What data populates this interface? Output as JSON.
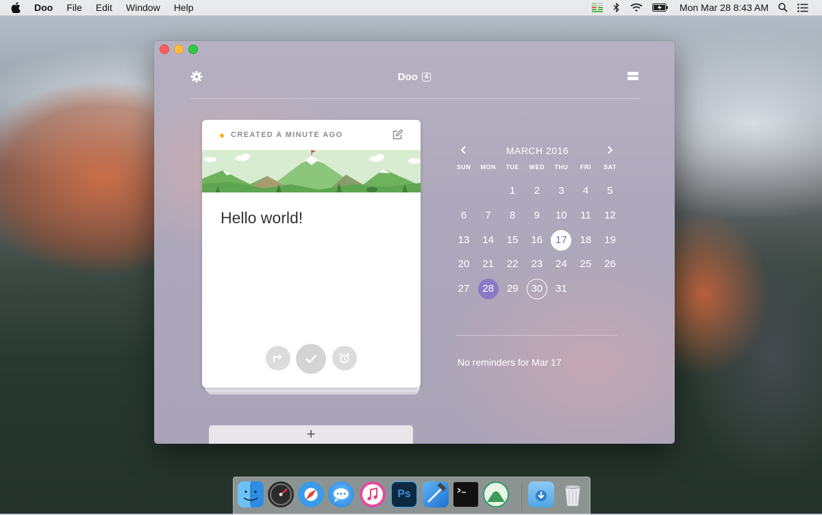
{
  "menubar": {
    "app_name": "Doo",
    "items": [
      "File",
      "Edit",
      "Window",
      "Help"
    ],
    "clock": "Mon Mar 28  8:43 AM"
  },
  "app": {
    "title": "Doo",
    "badge_count": "4"
  },
  "note": {
    "created_label": "CREATED A MINUTE AGO",
    "text": "Hello world!",
    "add_label": "+"
  },
  "calendar": {
    "month_label": "MARCH 2016",
    "weekdays": [
      "SUN",
      "MON",
      "TUE",
      "WED",
      "THU",
      "FRI",
      "SAT"
    ],
    "first_weekday_index": 2,
    "days_in_month": 31,
    "today": 17,
    "selected": 28,
    "ringed": 30
  },
  "reminders": {
    "empty_text": "No reminders for Mar 17"
  },
  "dock": {
    "apps": [
      "finder-icon",
      "dashboard-icon",
      "safari-icon",
      "messages-icon",
      "itunes-icon",
      "photoshop-icon",
      "xcode-icon",
      "terminal-icon",
      "doo-icon",
      "downloads-folder-icon",
      "trash-icon"
    ],
    "photoshop_label": "Ps"
  },
  "colors": {
    "selected_day": "#8a79c6",
    "created_dot": "#f5b31b"
  }
}
